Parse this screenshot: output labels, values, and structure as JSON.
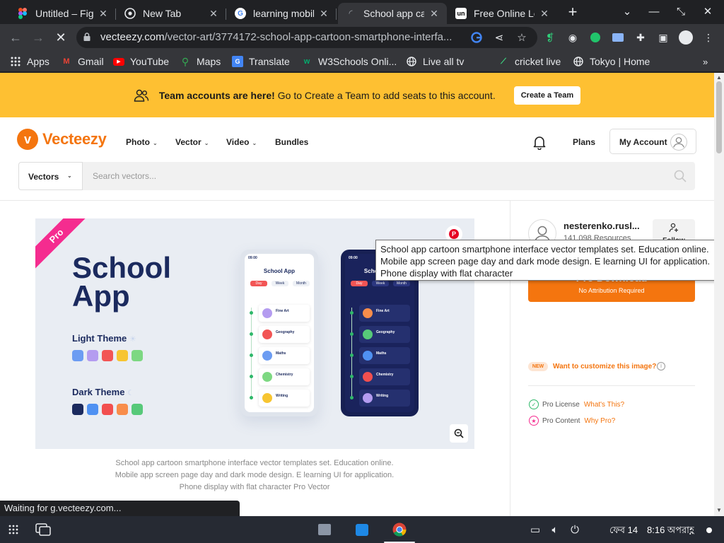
{
  "browser": {
    "tabs": [
      {
        "title": "Untitled – Figma",
        "icon": "figma-icon",
        "color": "#a259ff"
      },
      {
        "title": "New Tab",
        "icon": "chrome-icon",
        "color": "#e8eaed"
      },
      {
        "title": "learning mobile",
        "icon": "google-icon",
        "color": "#4285f4"
      },
      {
        "title": "School app cartoon",
        "icon": "loading-icon",
        "color": "#e8eaed"
      },
      {
        "title": "Free Online Learning",
        "icon": "unacademy-icon",
        "color": "#ffffff"
      }
    ],
    "url_host": "vecteezy.com",
    "url_path": "/vector-art/3774172-school-app-cartoon-smartphone-interfa...",
    "bookmarks": [
      {
        "label": "Apps",
        "icon": "apps-grid-icon"
      },
      {
        "label": "Gmail",
        "icon": "gmail-icon"
      },
      {
        "label": "YouTube",
        "icon": "youtube-icon"
      },
      {
        "label": "Maps",
        "icon": "maps-icon"
      },
      {
        "label": "Translate",
        "icon": "translate-icon"
      },
      {
        "label": "W3Schools Onli...",
        "icon": "w3schools-icon"
      },
      {
        "label": "Live all tv",
        "icon": "globe-icon"
      },
      {
        "label": "cricket live",
        "icon": "cricket-icon"
      },
      {
        "label": "Tokyo | Home",
        "icon": "globe-icon"
      }
    ],
    "status_text": "Waiting for g.vecteezy.com..."
  },
  "banner": {
    "strong": "Team accounts are here!",
    "text": "Go to Create a Team to add seats to this account.",
    "cta": "Create a Team"
  },
  "header": {
    "brand": "Vecteezy",
    "brand_color": "#f4750f",
    "nav": [
      "Photo",
      "Vector",
      "Video",
      "Bundles"
    ],
    "plans": "Plans",
    "account": "My Account"
  },
  "search": {
    "category": "Vectors",
    "placeholder": "Search vectors..."
  },
  "preview": {
    "ribbon": "Pro",
    "title_line1": "School",
    "title_line2": "App",
    "light_theme": "Light Theme",
    "dark_theme": "Dark Theme",
    "light_swatches": [
      "#6c9cf2",
      "#b49cf0",
      "#f25555",
      "#f7c531",
      "#7dd882"
    ],
    "dark_swatches": [
      "#1b2a5e",
      "#4f91f2",
      "#f24f4f",
      "#f88d4b",
      "#57c979"
    ],
    "phone_title": "School App",
    "phone_time": "09:00",
    "phone_tabs": [
      "Day",
      "Week",
      "Month"
    ],
    "phone_items": [
      {
        "name": "Fine Art",
        "color": "#b49cf0"
      },
      {
        "name": "Geography",
        "color": "#f25555"
      },
      {
        "name": "Maths",
        "color": "#6c9cf2"
      },
      {
        "name": "Chemistry",
        "color": "#7dd882"
      },
      {
        "name": "Writing",
        "color": "#f7c531"
      }
    ],
    "dark_items": [
      {
        "name": "Fine Art",
        "color": "#f88d4b"
      },
      {
        "name": "Geography",
        "color": "#57c979"
      },
      {
        "name": "Maths",
        "color": "#4f91f2"
      },
      {
        "name": "Chemistry",
        "color": "#f24f4f"
      },
      {
        "name": "Writing",
        "color": "#b49cf0"
      }
    ],
    "caption": "School app cartoon smartphone interface vector templates set. Education online. Mobile app screen page day and dark mode design. E learning UI for application. Phone display with flat character Pro Vector"
  },
  "author": {
    "name": "nesterenko.rusl...",
    "resources": "141,098 Resources",
    "follow": "Follow"
  },
  "download": {
    "label": "Pro Download",
    "sub": "No Attribution Required"
  },
  "customize": {
    "badge": "NEW",
    "text": "Want to customize this image?"
  },
  "license": {
    "pro_license": "Pro License",
    "whats_this": "What's This?",
    "pro_content": "Pro Content",
    "why_pro": "Why Pro?"
  },
  "tooltip": "School app cartoon smartphone interface vector templates set. Education online. Mobile app screen page day and dark mode design. E learning UI for application. Phone display with flat character",
  "shelf": {
    "date": "ফেব 14",
    "time": "8:16 অপরাহ্ণ"
  }
}
